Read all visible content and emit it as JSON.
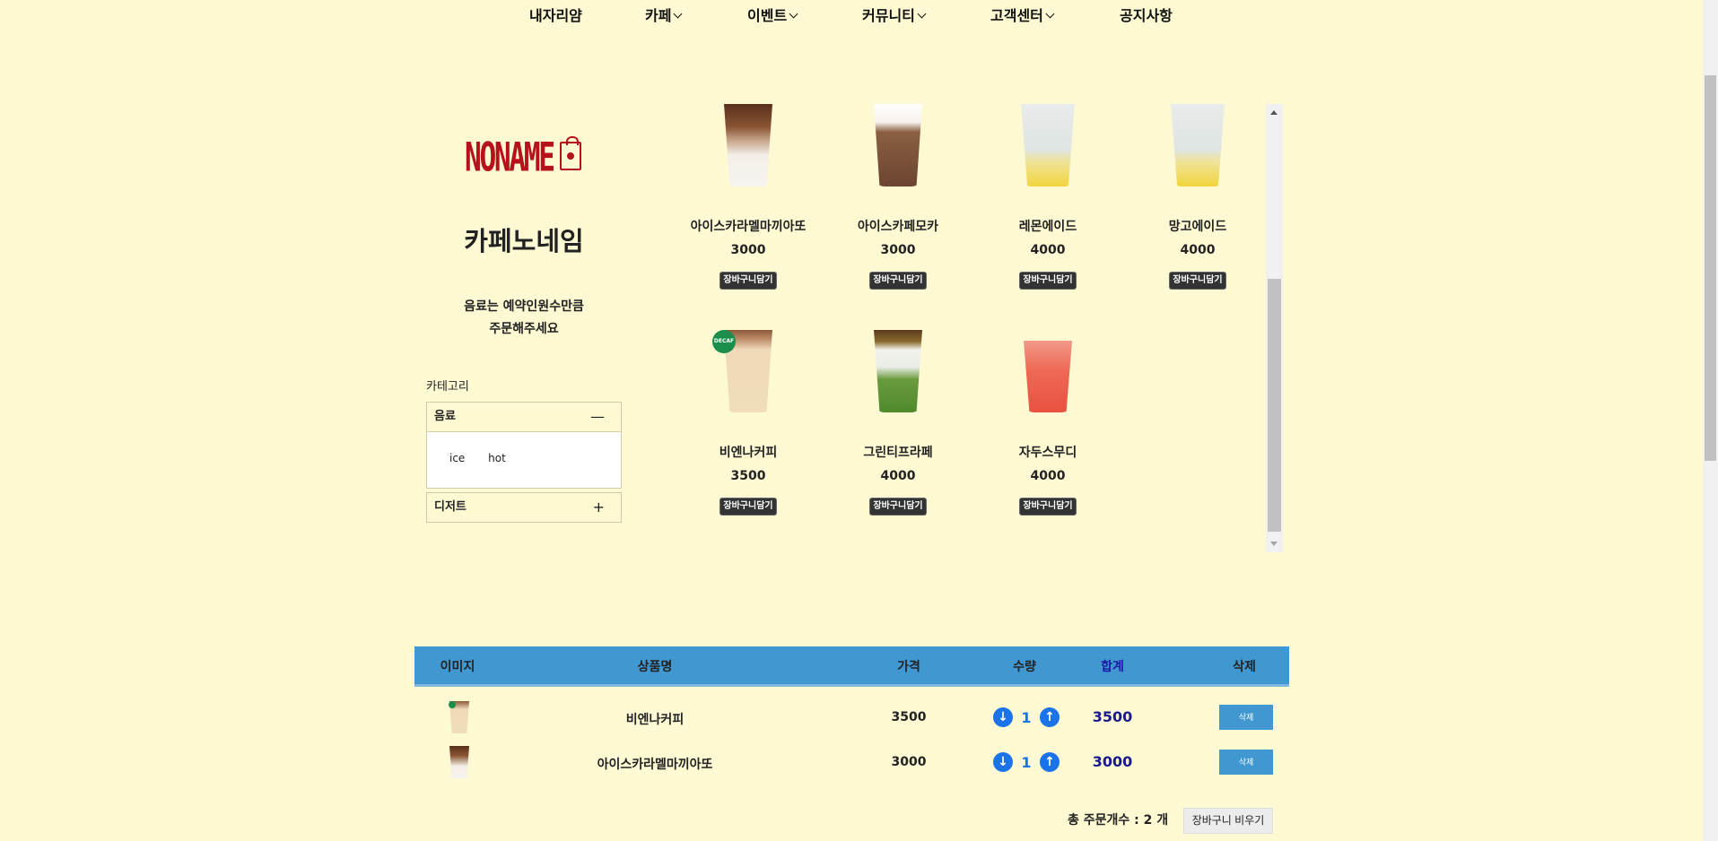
{
  "nav": {
    "items": [
      {
        "label": "내자리얌",
        "dropdown": false
      },
      {
        "label": "카페",
        "dropdown": true
      },
      {
        "label": "이벤트",
        "dropdown": true
      },
      {
        "label": "커뮤니티",
        "dropdown": true
      },
      {
        "label": "고객센터",
        "dropdown": true
      },
      {
        "label": "공지사항",
        "dropdown": false
      }
    ]
  },
  "sidebar": {
    "logo_text": "NONAME",
    "cafe_name": "카페노네임",
    "notice_line1": "음료는 예약인원수만큼",
    "notice_line2": "주문해주세요",
    "category_heading": "카테고리",
    "categories": [
      {
        "label": "음료",
        "sign": "—",
        "expanded": true,
        "subitems": [
          "ice",
          "hot"
        ]
      },
      {
        "label": "디저트",
        "sign": "+",
        "expanded": false
      }
    ]
  },
  "products": [
    {
      "name": "아이스카라멜마끼아또",
      "price": "3000",
      "button": "장바구니담기",
      "image": "iced-caramel-macchiato"
    },
    {
      "name": "아이스카페모카",
      "price": "3000",
      "button": "장바구니담기",
      "image": "iced-cafe-mocha"
    },
    {
      "name": "레몬에이드",
      "price": "4000",
      "button": "장바구니담기",
      "image": "lemonade"
    },
    {
      "name": "망고에이드",
      "price": "4000",
      "button": "장바구니담기",
      "image": "mangoade"
    },
    {
      "name": "비엔나커피",
      "price": "3500",
      "button": "장바구니담기",
      "image": "vienna-coffee",
      "badge": "DECAF"
    },
    {
      "name": "그린티프라페",
      "price": "4000",
      "button": "장바구니담기",
      "image": "green-tea-frappe"
    },
    {
      "name": "자두스무디",
      "price": "4000",
      "button": "장바구니담기",
      "image": "plum-smoothie"
    }
  ],
  "cart": {
    "headers": {
      "image": "이미지",
      "name": "상품명",
      "price": "가격",
      "qty": "수량",
      "total": "합계",
      "delete": "삭제"
    },
    "rows": [
      {
        "name": "비엔나커피",
        "price": "3500",
        "qty": "1",
        "total": "3500",
        "delete_label": "삭제",
        "image": "vienna-coffee"
      },
      {
        "name": "아이스카라멜마끼아또",
        "price": "3000",
        "qty": "1",
        "total": "3000",
        "delete_label": "삭제",
        "image": "iced-caramel-macchiato"
      }
    ],
    "summary": "총 주문개수 : 2 개",
    "empty_button": "장바구니 비우기",
    "qty_down_icon": "↓",
    "qty_up_icon": "↑"
  },
  "colors": {
    "background": "#fcf9d3",
    "header_bar": "#4197d0",
    "logo_red": "#b5121b",
    "qty_blue": "#1a73e8",
    "total_navy": "#1a1aa6"
  }
}
